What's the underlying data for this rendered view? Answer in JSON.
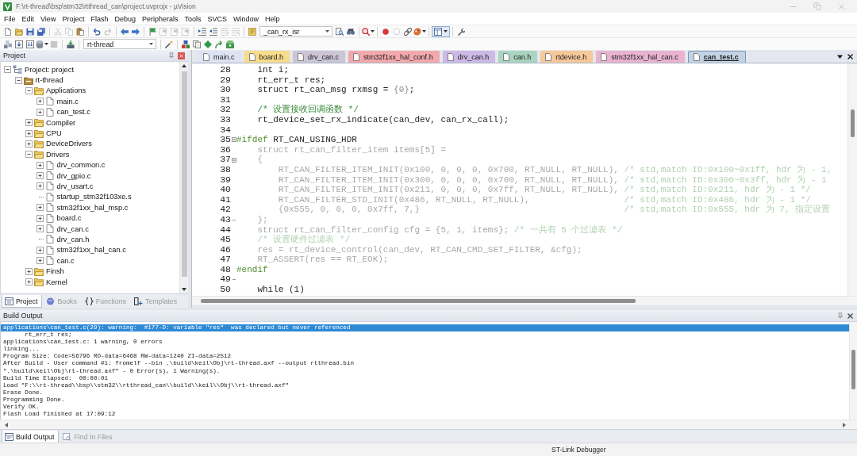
{
  "window": {
    "title": "F:\\rt-thread\\bsp\\stm32\\rtthread_can\\project.uvprojx - µVision"
  },
  "menu": [
    "File",
    "Edit",
    "View",
    "Project",
    "Flash",
    "Debug",
    "Peripherals",
    "Tools",
    "SVCS",
    "Window",
    "Help"
  ],
  "toolbars": [
    [
      [
        {
          "kind": "new-file",
          "disabled": false
        },
        {
          "kind": "open-folder",
          "disabled": false
        },
        {
          "kind": "save",
          "disabled": false
        },
        {
          "kind": "save-all",
          "disabled": false
        }
      ],
      [
        {
          "kind": "cut",
          "disabled": true
        },
        {
          "kind": "copy",
          "disabled": true
        },
        {
          "kind": "paste",
          "disabled": false
        }
      ],
      [
        {
          "kind": "undo",
          "disabled": false
        },
        {
          "kind": "redo",
          "disabled": true
        }
      ],
      [
        {
          "kind": "back",
          "disabled": false
        },
        {
          "kind": "forward",
          "disabled": false
        }
      ],
      [
        {
          "kind": "bookmark",
          "disabled": false
        },
        {
          "kind": "prev-bookmark",
          "disabled": true
        },
        {
          "kind": "next-bookmark",
          "disabled": true
        },
        {
          "kind": "clear-bookmarks",
          "disabled": true
        }
      ],
      [
        {
          "kind": "indent",
          "disabled": false
        },
        {
          "kind": "unindent",
          "disabled": false
        },
        {
          "kind": "comment",
          "disabled": true
        },
        {
          "kind": "uncomment",
          "disabled": true
        }
      ],
      [
        {
          "kind": "find-note",
          "disabled": false
        },
        {
          "kind": "combo",
          "value": "_can_rx_isr"
        },
        {
          "kind": "find",
          "disabled": false
        },
        {
          "kind": "incremental-find",
          "disabled": false
        }
      ],
      [
        {
          "kind": "debug",
          "disabled": false
        }
      ],
      [
        {
          "kind": "breakpoint",
          "disabled": false
        },
        {
          "kind": "breakpoint-off",
          "disabled": true
        },
        {
          "kind": "link",
          "disabled": false
        },
        {
          "kind": "palette",
          "disabled": false
        }
      ],
      [
        {
          "kind": "window",
          "disabled": false
        }
      ],
      [
        {
          "kind": "wrench",
          "disabled": false
        }
      ]
    ],
    [
      [
        {
          "kind": "translate",
          "disabled": false
        },
        {
          "kind": "build",
          "disabled": false
        },
        {
          "kind": "rebuild",
          "disabled": false
        },
        {
          "kind": "batch",
          "disabled": false
        },
        {
          "kind": "stop",
          "disabled": true
        }
      ],
      [
        {
          "kind": "load",
          "disabled": false
        }
      ],
      [
        {
          "kind": "combo",
          "value": "rt-thread"
        }
      ],
      [
        {
          "kind": "options",
          "disabled": false
        }
      ],
      [
        {
          "kind": "manage",
          "disabled": false
        },
        {
          "kind": "file-ext",
          "disabled": false
        },
        {
          "kind": "diamond",
          "disabled": false
        },
        {
          "kind": "arrow",
          "disabled": false
        },
        {
          "kind": "pack",
          "disabled": false
        }
      ]
    ]
  ],
  "project_panel": {
    "title": "Project",
    "tree": [
      {
        "label": "Project: project",
        "kind": "project",
        "expandable": true,
        "expanded": true,
        "children": [
          {
            "label": "rt-thread",
            "kind": "target",
            "expandable": true,
            "expanded": true,
            "children": [
              {
                "label": "Applications",
                "kind": "folder",
                "expandable": true,
                "expanded": true,
                "children": [
                  {
                    "label": "main.c",
                    "kind": "file",
                    "expandable": true,
                    "expanded": false
                  },
                  {
                    "label": "can_test.c",
                    "kind": "file",
                    "expandable": true,
                    "expanded": false
                  }
                ]
              },
              {
                "label": "Compiler",
                "kind": "folder",
                "expandable": true,
                "expanded": false
              },
              {
                "label": "CPU",
                "kind": "folder",
                "expandable": true,
                "expanded": false
              },
              {
                "label": "DeviceDrivers",
                "kind": "folder",
                "expandable": true,
                "expanded": false
              },
              {
                "label": "Drivers",
                "kind": "folder",
                "expandable": true,
                "expanded": true,
                "children": [
                  {
                    "label": "drv_common.c",
                    "kind": "file",
                    "expandable": true,
                    "expanded": false
                  },
                  {
                    "label": "drv_gpio.c",
                    "kind": "file",
                    "expandable": true,
                    "expanded": false
                  },
                  {
                    "label": "drv_usart.c",
                    "kind": "file",
                    "expandable": true,
                    "expanded": false
                  },
                  {
                    "label": "startup_stm32f103xe.s",
                    "kind": "file",
                    "expandable": false
                  },
                  {
                    "label": "stm32f1xx_hal_msp.c",
                    "kind": "file",
                    "expandable": true,
                    "expanded": false
                  },
                  {
                    "label": "board.c",
                    "kind": "file",
                    "expandable": true,
                    "expanded": false
                  },
                  {
                    "label": "drv_can.c",
                    "kind": "file",
                    "expandable": true,
                    "expanded": false
                  },
                  {
                    "label": "drv_can.h",
                    "kind": "file",
                    "expandable": false
                  },
                  {
                    "label": "stm32f1xx_hal_can.c",
                    "kind": "file",
                    "expandable": true,
                    "expanded": false
                  },
                  {
                    "label": "can.c",
                    "kind": "file",
                    "expandable": true,
                    "expanded": false
                  }
                ]
              },
              {
                "label": "Finsh",
                "kind": "folder",
                "expandable": true,
                "expanded": false
              },
              {
                "label": "Kernel",
                "kind": "folder",
                "expandable": true,
                "expanded": false
              }
            ]
          }
        ]
      }
    ],
    "tabs": [
      {
        "label": "Project",
        "kind": "project",
        "selected": true
      },
      {
        "label": "Books",
        "kind": "books",
        "selected": false
      },
      {
        "label": "Functions",
        "kind": "functions",
        "selected": false
      },
      {
        "label": "Templates",
        "kind": "templates",
        "selected": false
      }
    ]
  },
  "editor": {
    "tabs": [
      {
        "label": "main.c",
        "color": "#dde3f3",
        "selected": false
      },
      {
        "label": "board.h",
        "color": "#f7dc8c",
        "selected": false
      },
      {
        "label": "drv_can.c",
        "color": "#cbc5d5",
        "selected": false
      },
      {
        "label": "stm32f1xx_hal_conf.h",
        "color": "#f2a9ae",
        "selected": false
      },
      {
        "label": "drv_can.h",
        "color": "#cdb9e6",
        "selected": false
      },
      {
        "label": "can.h",
        "color": "#a9d4c0",
        "selected": false
      },
      {
        "label": "rtdevice.h",
        "color": "#f7c89a",
        "selected": false
      },
      {
        "label": "stm32f1xx_hal_can.c",
        "color": "#e9b3cf",
        "selected": false
      },
      {
        "label": "can_test.c",
        "color": "#c3d3e4",
        "selected": true
      }
    ],
    "lines": [
      {
        "number": "28",
        "inactive": false,
        "fold_start": false,
        "fold_end": false,
        "segments": [
          {
            "kind": "code",
            "text": "    int i;"
          }
        ]
      },
      {
        "number": "29",
        "inactive": false,
        "fold_start": false,
        "fold_end": false,
        "segments": [
          {
            "kind": "code",
            "text": "    rt_err_t res;"
          }
        ]
      },
      {
        "number": "30",
        "inactive": false,
        "fold_start": false,
        "fold_end": false,
        "segments": [
          {
            "kind": "code",
            "text": "    struct rt_can_msg rxmsg = "
          },
          {
            "kind": "literal",
            "text": "{0}"
          },
          {
            "kind": "code",
            "text": ";"
          }
        ]
      },
      {
        "number": "31",
        "fold_start": false,
        "fold_end": false
      },
      {
        "number": "32",
        "inactive": false,
        "fold_start": false,
        "fold_end": false,
        "segments": [
          {
            "kind": "comment",
            "text": "    /* 设置接收回调函数 */"
          }
        ]
      },
      {
        "number": "33",
        "inactive": false,
        "fold_start": false,
        "fold_end": false,
        "segments": [
          {
            "kind": "code",
            "text": "    rt_device_set_rx_indicate(can_dev, can_rx_call);"
          }
        ]
      },
      {
        "number": "34",
        "fold_start": false,
        "fold_end": false
      },
      {
        "number": "35",
        "inactive": false,
        "fold_start": true,
        "fold_end": false,
        "segments": [
          {
            "kind": "directive",
            "text": "#ifdef"
          },
          {
            "kind": "code",
            "text": " RT_CAN_USING_HDR"
          }
        ]
      },
      {
        "number": "36",
        "inactive": true,
        "fold_start": false,
        "fold_end": false,
        "segments": [
          {
            "kind": "code",
            "text": "    struct rt_can_filter_item items[5] ="
          }
        ]
      },
      {
        "number": "37",
        "inactive": true,
        "fold_start": true,
        "fold_end": false,
        "segments": [
          {
            "kind": "code",
            "text": "    {"
          }
        ]
      },
      {
        "number": "38",
        "inactive": true,
        "fold_start": false,
        "fold_end": false,
        "segments": [
          {
            "kind": "code",
            "text": "        RT_CAN_FILTER_ITEM_INIT(0x100, 0, 0, 0, 0x700, RT_NULL, RT_NULL), "
          },
          {
            "kind": "comment",
            "text": "/* std,match ID:0x100~0x1ff, hdr 为 - 1,"
          }
        ]
      },
      {
        "number": "39",
        "inactive": true,
        "fold_start": false,
        "fold_end": false,
        "segments": [
          {
            "kind": "code",
            "text": "        RT_CAN_FILTER_ITEM_INIT(0x300, 0, 0, 0, 0x700, RT_NULL, RT_NULL), "
          },
          {
            "kind": "comment",
            "text": "/* std,match ID:0x300~0x3ff, hdr 为 - 1"
          }
        ]
      },
      {
        "number": "40",
        "inactive": true,
        "fold_start": false,
        "fold_end": false,
        "segments": [
          {
            "kind": "code",
            "text": "        RT_CAN_FILTER_ITEM_INIT(0x211, 0, 0, 0, 0x7ff, RT_NULL, RT_NULL), "
          },
          {
            "kind": "comment",
            "text": "/* std,match ID:0x211, hdr 为 - 1 */"
          }
        ]
      },
      {
        "number": "41",
        "inactive": true,
        "fold_start": false,
        "fold_end": false,
        "segments": [
          {
            "kind": "code",
            "text": "        RT_CAN_FILTER_STD_INIT(0x486, RT_NULL, RT_NULL),                  "
          },
          {
            "kind": "comment",
            "text": "/* std,match ID:0x486, hdr 为 - 1 */"
          }
        ]
      },
      {
        "number": "42",
        "inactive": true,
        "fold_start": false,
        "fold_end": false,
        "segments": [
          {
            "kind": "code",
            "text": "        {0x555, 0, 0, 0, 0x7ff, 7,}                                       "
          },
          {
            "kind": "comment",
            "text": "/* std,match ID:0x555, hdr 为 7, 指定设置"
          }
        ]
      },
      {
        "number": "43",
        "inactive": true,
        "fold_start": false,
        "fold_end": true,
        "segments": [
          {
            "kind": "code",
            "text": "    };"
          }
        ]
      },
      {
        "number": "44",
        "inactive": true,
        "fold_start": false,
        "fold_end": false,
        "segments": [
          {
            "kind": "code",
            "text": "    struct rt_can_filter_config cfg = {5, 1, items}; "
          },
          {
            "kind": "comment",
            "text": "/* 一共有 5 个过滤表 */"
          }
        ]
      },
      {
        "number": "45",
        "inactive": true,
        "fold_start": false,
        "fold_end": false,
        "segments": [
          {
            "kind": "comment",
            "text": "    /* 设置硬件过滤表 */"
          }
        ]
      },
      {
        "number": "46",
        "inactive": true,
        "fold_start": false,
        "fold_end": false,
        "segments": [
          {
            "kind": "code",
            "text": "    res = rt_device_control(can_dev, RT_CAN_CMD_SET_FILTER, &cfg);"
          }
        ]
      },
      {
        "number": "47",
        "inactive": true,
        "fold_start": false,
        "fold_end": false,
        "segments": [
          {
            "kind": "code",
            "text": "    RT_ASSERT(res == RT_EOK);"
          }
        ]
      },
      {
        "number": "48",
        "inactive": false,
        "fold_start": false,
        "fold_end": false,
        "segments": [
          {
            "kind": "directive",
            "text": "#endif"
          }
        ]
      },
      {
        "number": "49",
        "fold_start": false,
        "fold_end": true
      },
      {
        "number": "50",
        "inactive": false,
        "fold_start": false,
        "fold_end": false,
        "segments": [
          {
            "kind": "code",
            "text": "    while (1)"
          }
        ]
      }
    ]
  },
  "build_output": {
    "title": "Build Output",
    "lines": [
      {
        "text": "applications\\can_test.c(29): warning:  #177-D: variable \"res\"  was declared but never referenced",
        "selected": true
      },
      {
        "text": "      rt_err_t res;",
        "selected": false
      },
      {
        "text": "applications\\can_test.c: 1 warning, 0 errors",
        "selected": false
      },
      {
        "text": "linking...",
        "selected": false
      },
      {
        "text": "Program Size: Code=56796 RO-data=6468 RW-data=1240 ZI-data=2512",
        "selected": false
      },
      {
        "text": "After Build - User command #1: fromelf --bin .\\build\\keil\\Obj\\rt-thread.axf --output rtthread.bin",
        "selected": false
      },
      {
        "text": "\".\\build\\keil\\Obj\\rt-thread.axf\" - 0 Error(s), 1 Warning(s).",
        "selected": false
      },
      {
        "text": "Build Time Elapsed:  00:00:01",
        "selected": false
      },
      {
        "text": "Load \"F:\\\\rt-thread\\\\bsp\\\\stm32\\\\rtthread_can\\\\build\\\\keil\\\\Obj\\\\rt-thread.axf\"",
        "selected": false
      },
      {
        "text": "Erase Done.",
        "selected": false
      },
      {
        "text": "Programming Done.",
        "selected": false
      },
      {
        "text": "Verify OK.",
        "selected": false
      },
      {
        "text": "Flash Load finished at 17:09:12",
        "selected": false
      }
    ],
    "tabs": [
      {
        "label": "Build Output",
        "kind": "build",
        "selected": true
      },
      {
        "label": "Find In Files",
        "kind": "find",
        "selected": false
      }
    ]
  },
  "status_bar": {
    "debugger": "ST-Link Debugger"
  }
}
